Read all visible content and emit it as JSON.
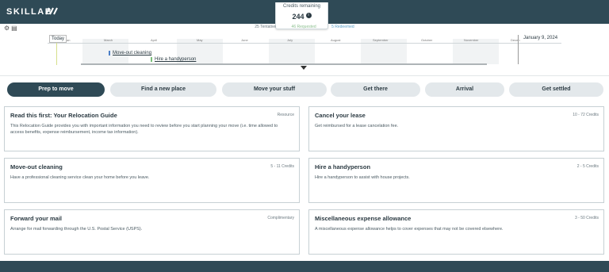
{
  "header": {
    "logo": "SKILLAB",
    "credits_label": "Credits remaining",
    "credits_value": "244",
    "info_glyph": "i"
  },
  "stats": {
    "tentative": "25 Tentative",
    "requested": "46 Requested",
    "redeemed": "5 Redeemed"
  },
  "controls": {
    "icons": [
      "settings-icon",
      "calendar-icon"
    ],
    "glyph_1": "⚙",
    "glyph_2": "▤"
  },
  "timeline": {
    "today_label": "Today",
    "end_date": "January 9, 2024",
    "months": [
      "Jan",
      "March",
      "April",
      "May",
      "June",
      "July",
      "August",
      "September",
      "October",
      "November",
      "Decen"
    ],
    "events": [
      "Move-out cleaning",
      "Hire a handyperson"
    ]
  },
  "tabs": [
    {
      "label": "Prep to move",
      "active": true
    },
    {
      "label": "Find a new place",
      "active": false
    },
    {
      "label": "Move your stuff",
      "active": false
    },
    {
      "label": "Get there",
      "active": false
    },
    {
      "label": "Arrival",
      "active": false
    },
    {
      "label": "Get settled",
      "active": false
    }
  ],
  "cards": [
    {
      "title": "Read this first: Your Relocation Guide",
      "credits": "Resource",
      "desc": "This Relocation Guide provides you with important information you need to review before you start planning your move (i.e. time allowed to access benefits, expense reimbursement, income tax information)."
    },
    {
      "title": "Cancel your lease",
      "credits": "10 - 72  Credits",
      "desc": "Get reimbursed for a lease cancelation fee."
    },
    {
      "title": "Move-out cleaning",
      "credits": "5 - 11  Credits",
      "desc": "Have a professional cleaning service clean your home before you leave."
    },
    {
      "title": "Hire a handyperson",
      "credits": "2 - 5  Credits",
      "desc": "Hire a handyperson to assist with house projects."
    },
    {
      "title": "Forward your mail",
      "credits": "Complimentary",
      "desc": "Arrange for mail forwarding through the U.S. Postal Service (USPS)."
    },
    {
      "title": "Miscellaneous expense allowance",
      "credits": "3 - 50  Credits",
      "desc": "A miscellaneous expense allowance helps to cover expenses that may not be covered elsewhere."
    }
  ],
  "colors": {
    "brand": "#2f4a56",
    "tab_inactive": "#e3e8eb",
    "event_blue": "#4b7fc7",
    "event_green": "#7bbf7b"
  }
}
